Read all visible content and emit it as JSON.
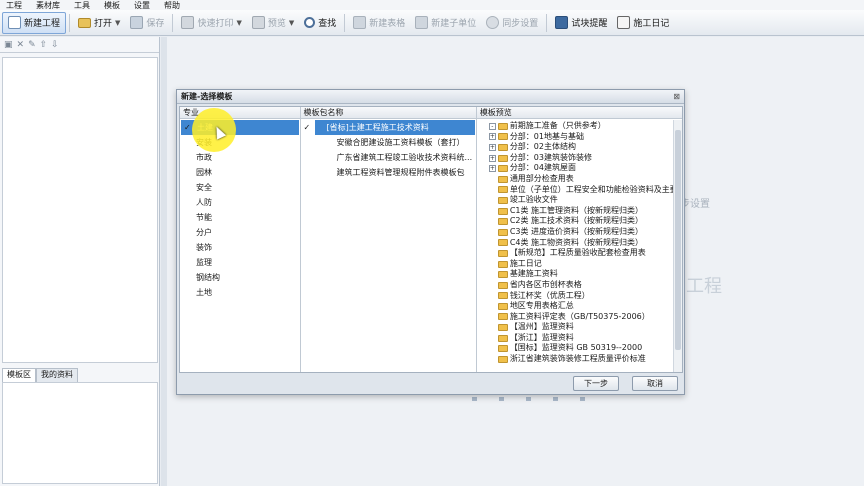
{
  "menu": [
    "工程",
    "素材库",
    "工具",
    "模板",
    "设置",
    "帮助"
  ],
  "toolbar": {
    "new_project": "新建工程",
    "open": "打开",
    "save": "保存",
    "quick_print": "快速打印",
    "preview": "预览",
    "find": "查找",
    "new_form": "新建表格",
    "new_sub_unit": "新建子单位",
    "sync_settings": "同步设置",
    "test_reminder": "试块提醒",
    "construction_log": "施工日记"
  },
  "left_panel": {
    "tab_templates": "模板区",
    "tab_my_data": "我的资料"
  },
  "workspace": {
    "hint_text": "步设置",
    "hint_text2": "工程"
  },
  "dialog": {
    "title": "新建-选择模板",
    "close_label": "⊠",
    "col_specialty": "专业",
    "col_package": "模板包名称",
    "col_preview": "模板预览",
    "specialties": [
      {
        "label": "土建",
        "selected": true
      },
      {
        "label": "安装"
      },
      {
        "label": "市政"
      },
      {
        "label": "园林"
      },
      {
        "label": "安全"
      },
      {
        "label": "人防"
      },
      {
        "label": "节能"
      },
      {
        "label": "分户"
      },
      {
        "label": "装饰"
      },
      {
        "label": "监理"
      },
      {
        "label": "钢结构"
      },
      {
        "label": "土地"
      }
    ],
    "packages": [
      {
        "label": "[省标]土建工程施工技术资料",
        "selected": true
      },
      {
        "label": "安徽合肥建设施工资料模板（套打）"
      },
      {
        "label": "广东省建筑工程竣工验收技术资料统..."
      },
      {
        "label": "建筑工程资料管理规程附件表模板包"
      }
    ],
    "preview_tree": [
      {
        "label": "前期施工准备（只供参考）",
        "expander": "-"
      },
      {
        "label": "分部：01地基与基础",
        "expander": "+"
      },
      {
        "label": "分部：02主体结构",
        "expander": "+"
      },
      {
        "label": "分部：03建筑装饰装修",
        "expander": "+"
      },
      {
        "label": "分部：04建筑屋面",
        "expander": "+"
      },
      {
        "label": "通用部分检查用表",
        "expander": ""
      },
      {
        "label": "单位（子单位）工程安全和功能检验资料及主要",
        "expander": ""
      },
      {
        "label": "竣工验收文件",
        "expander": ""
      },
      {
        "label": "C1类 施工管理资料（按新规程归类）",
        "expander": ""
      },
      {
        "label": "C2类 施工技术资料（按新规程归类）",
        "expander": ""
      },
      {
        "label": "C3类 进度造价资料（按新规程归类）",
        "expander": ""
      },
      {
        "label": "C4类 施工物资资料（按新规程归类）",
        "expander": ""
      },
      {
        "label": "【新规范】工程质量验收配套检查用表",
        "expander": ""
      },
      {
        "label": "施工日记",
        "expander": ""
      },
      {
        "label": "基建施工资料",
        "expander": ""
      },
      {
        "label": "省内各区市创杯表格",
        "expander": ""
      },
      {
        "label": "钱江杯奖（优质工程）",
        "expander": ""
      },
      {
        "label": "地区专用表格汇总",
        "expander": ""
      },
      {
        "label": "施工资料评定表（GB/T50375-2006）",
        "expander": ""
      },
      {
        "label": "【温州】监理资料",
        "expander": ""
      },
      {
        "label": "【浙江】监理资料",
        "expander": ""
      },
      {
        "label": "【国标】监理资料 GB 50319--2000",
        "expander": ""
      },
      {
        "label": "浙江省建筑装饰装修工程质量评价标准",
        "expander": ""
      }
    ],
    "next_button": "下一步",
    "cancel_button": "取消"
  },
  "colors": {
    "selection": "#3e86d1",
    "folder": "#f0c04a",
    "cursor_highlight": "#ffee28"
  }
}
